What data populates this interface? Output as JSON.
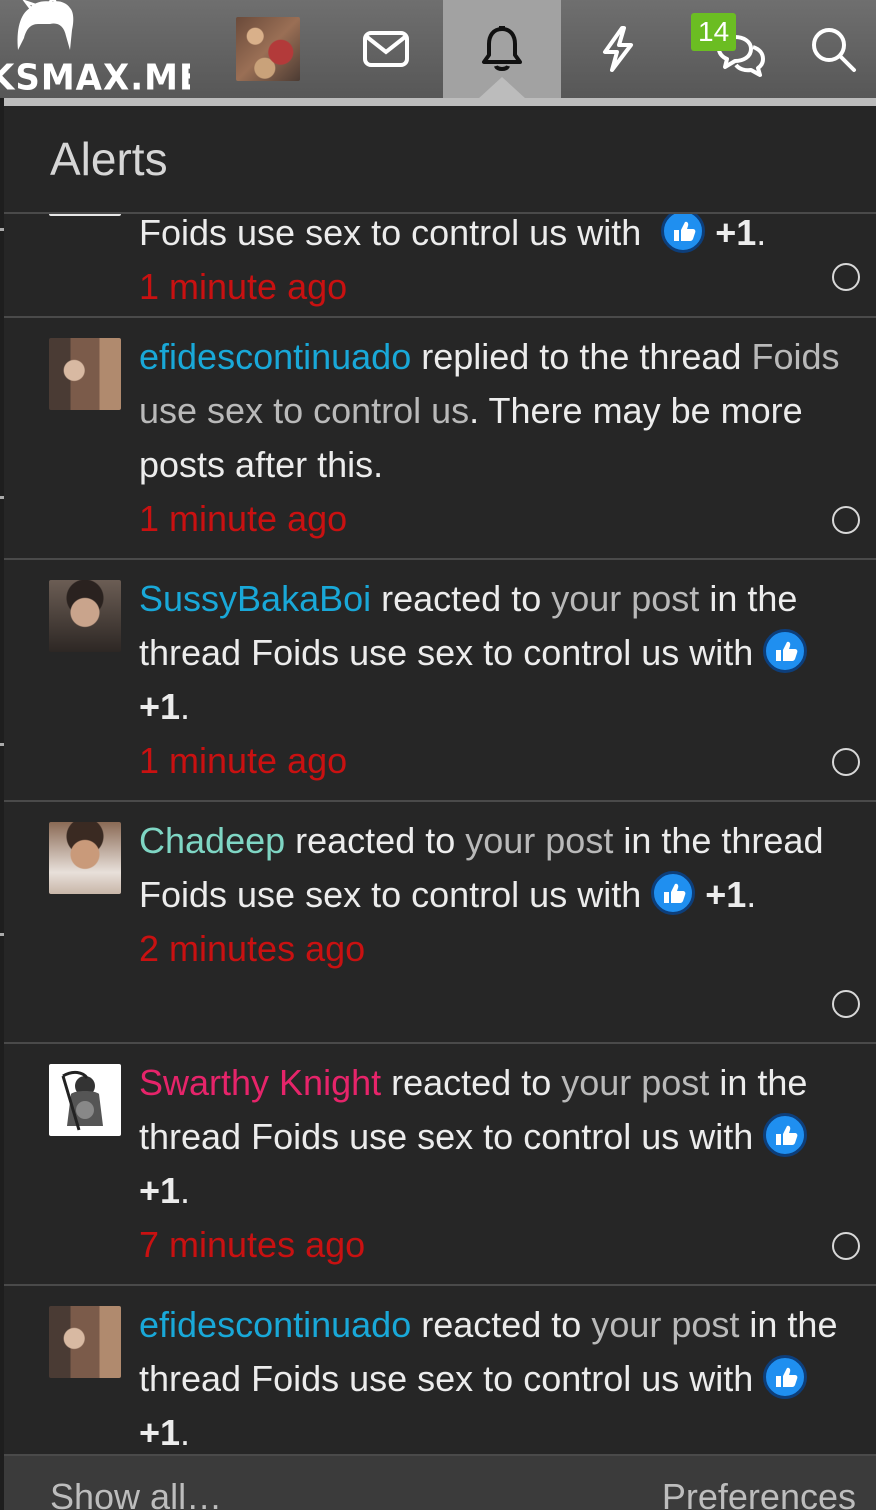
{
  "nav": {
    "logo_text": "KSMAX.ME",
    "badge_count": "14",
    "icons": [
      "hair-logo-icon",
      "avatar",
      "envelope-icon",
      "bell-icon",
      "lightning-icon",
      "chat-bubbles-icon",
      "search-icon"
    ]
  },
  "panel": {
    "title": "Alerts",
    "footer_show_all": "Show all…",
    "footer_preferences": "Preferences"
  },
  "alerts": [
    {
      "line1": "Foids use sex to control us with",
      "plus": "+1",
      "end": ".",
      "time": "1 minute ago"
    },
    {
      "user": "efidescontinuado",
      "action": " replied to the thread ",
      "thread": "Foids use sex to control us",
      "tail": ". There may be more posts after this.",
      "time": "1 minute ago"
    },
    {
      "user": "SussyBakaBoi",
      "action": " reacted to ",
      "your_post": "your post",
      "mid": " in the thread Foids use sex to control us with ",
      "plus": "+1",
      "end": ".",
      "time": "1 minute ago"
    },
    {
      "user": "Chadeep",
      "action": " reacted to ",
      "your_post": "your post",
      "mid": " in the thread Foids use sex to control us with ",
      "plus": "+1",
      "end": ".",
      "time": "2 minutes ago"
    },
    {
      "user": "Swarthy Knight",
      "action": " reacted to ",
      "your_post": "your post",
      "mid": " in the thread Foids use sex to control us with ",
      "plus": "+1",
      "end": ".",
      "time": "7 minutes ago"
    },
    {
      "user": "efidescontinuado",
      "action": " reacted to ",
      "your_post": "your post",
      "mid": " in the thread Foids use sex to control us with ",
      "plus": "+1",
      "end": "."
    }
  ],
  "colors": {
    "user_blue": "#19a8d8",
    "user_mint": "#7fd6c4",
    "user_pink": "#e6246a",
    "time_red": "#c91111",
    "badge_green": "#6bbd22"
  }
}
